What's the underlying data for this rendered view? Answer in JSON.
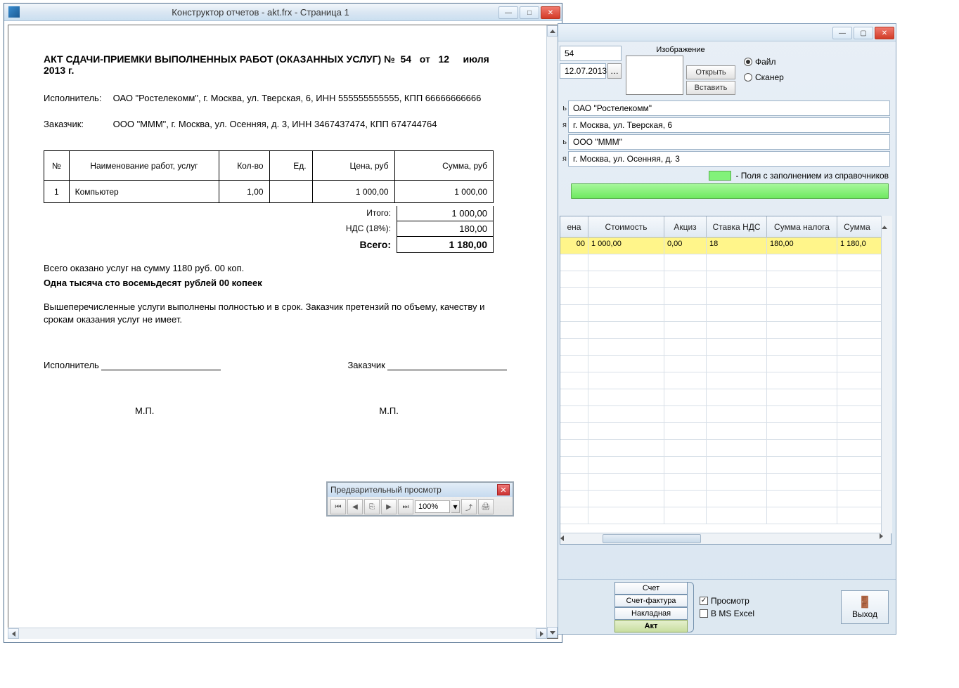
{
  "report_window": {
    "title": "Конструктор отчетов - akt.frx - Страница 1"
  },
  "akt": {
    "title_prefix": "АКТ СДАЧИ-ПРИЕМКИ ВЫПОЛНЕННЫХ РАБОТ (ОКАЗАННЫХ УСЛУГ)  №",
    "number": "54",
    "from": "от",
    "day": "12",
    "month": "июля",
    "year": "2013 г.",
    "executor_label": "Исполнитель:",
    "executor_text": "ОАО \"Ростелекомм\", г. Москва, ул. Тверская, 6, ИНН 555555555555, КПП 66666666666",
    "customer_label": "Заказчик:",
    "customer_text": "ООО \"МММ\", г. Москва, ул. Осенняя, д. 3, ИНН 3467437474, КПП 674744764",
    "headers": {
      "num": "№",
      "name": "Наименование работ, услуг",
      "qty": "Кол-во",
      "unit": "Ед.",
      "price": "Цена, руб",
      "sum": "Сумма, руб"
    },
    "rows": [
      {
        "num": "1",
        "name": "Компьютер",
        "qty": "1,00",
        "unit": "",
        "price": "1 000,00",
        "sum": "1 000,00"
      }
    ],
    "totals": {
      "subtotal_label": "Итого:",
      "subtotal": "1 000,00",
      "vat_label": "НДС (18%):",
      "vat": "180,00",
      "total_label": "Всего:",
      "total": "1 180,00"
    },
    "summary": "Всего оказано услуг на сумму 1180 руб. 00 коп.",
    "in_words": "Одна тысяча сто восемьдесят рублей 00 копеек",
    "note": "Вышеперечисленные услуги выполнены полностью и в срок. Заказчик претензий по объему, качеству и срокам оказания услуг не имеет.",
    "sign_executor": "Исполнитель",
    "sign_customer": "Заказчик",
    "mp": "М.П."
  },
  "preview": {
    "title": "Предварительный просмотр",
    "zoom": "100%"
  },
  "editor": {
    "image_label": "Изображение",
    "open_btn": "Открыть",
    "paste_btn": "Вставить",
    "source_file": "Файл",
    "source_scanner": "Сканер",
    "doc_number": "54",
    "doc_date": "12.07.2013",
    "label_suffix_b": "ь",
    "label_suffix_ya": "я",
    "executor_name": "ОАО \"Ростелекомм\"",
    "executor_addr": "г. Москва, ул. Тверская, 6",
    "customer_name": "ООО \"МММ\"",
    "customer_addr": "г. Москва, ул. Осенняя, д. 3",
    "hint_text": "- Поля с заполнением из справочников",
    "grid": {
      "headers": {
        "price": "ена",
        "cost": "Стоимость",
        "excise": "Акциз",
        "vat": "Ставка НДС",
        "tax": "Сумма налога",
        "sum": "Сумма"
      },
      "row": {
        "price": "00",
        "cost": "1 000,00",
        "excise": "0,00",
        "vat": "18",
        "tax": "180,00",
        "sum": "1 180,0"
      }
    },
    "buttons": {
      "invoice": "Счет",
      "invoice_fact": "Счет-фактура",
      "waybill": "Накладная",
      "akt": "Акт"
    },
    "chk_preview": "Просмотр",
    "chk_excel": "В MS Excel",
    "exit": "Выход"
  }
}
